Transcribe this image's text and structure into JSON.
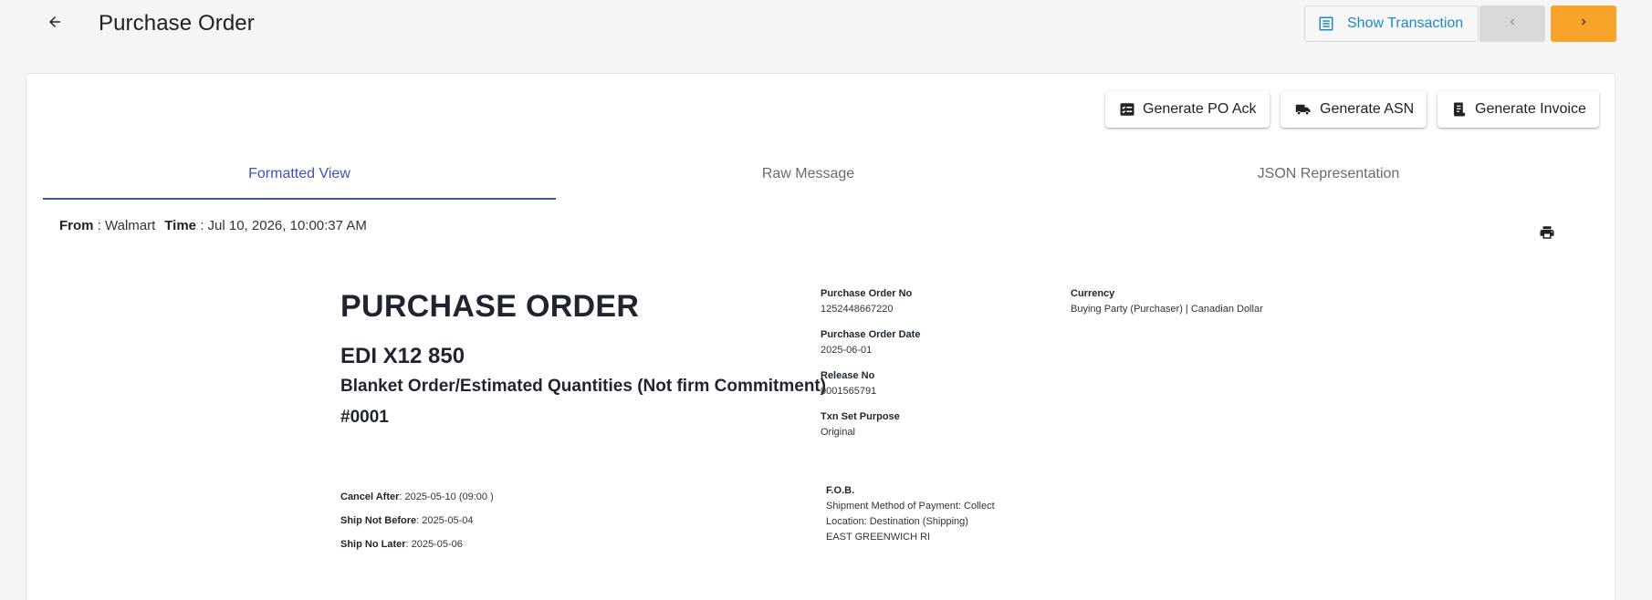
{
  "header": {
    "title": "Purchase Order",
    "show_transaction_label": "Show Transaction"
  },
  "actions": {
    "generate_po_ack": "Generate PO Ack",
    "generate_asn": "Generate ASN",
    "generate_invoice": "Generate Invoice"
  },
  "tabs": [
    {
      "label": "Formatted View",
      "active": true
    },
    {
      "label": "Raw Message",
      "active": false
    },
    {
      "label": "JSON Representation",
      "active": false
    }
  ],
  "meta": {
    "from_label": "From",
    "from_value": " : Walmart",
    "time_label": "Time",
    "time_value": " : Jul 10, 2026, 10:00:37 AM"
  },
  "document": {
    "title": "PURCHASE ORDER",
    "standard": "EDI X12 850",
    "order_type": "Blanket Order/Estimated Quantities (Not firm Commitment)",
    "number": "#0001",
    "fields": {
      "po_no_label": "Purchase Order No",
      "po_no_value": "1252448667220",
      "po_date_label": "Purchase Order Date",
      "po_date_value": "2025-06-01",
      "release_label": "Release No",
      "release_value": "0001565791",
      "txn_purpose_label": "Txn Set Purpose",
      "txn_purpose_value": "Original",
      "currency_label": "Currency",
      "currency_value": "Buying Party (Purchaser) | Canadian Dollar"
    },
    "dates": {
      "cancel_after_label": "Cancel After",
      "cancel_after_value": ": 2025-05-10  (09:00 )",
      "ship_not_before_label": "Ship Not Before",
      "ship_not_before_value": ": 2025-05-04",
      "ship_no_later_label": "Ship No Later",
      "ship_no_later_value": ": 2025-05-06"
    },
    "fob": {
      "label": "F.O.B.",
      "payment": "Shipment Method of Payment: Collect",
      "location": "Location: Destination (Shipping)",
      "place": "EAST GREENWICH RI"
    }
  },
  "colors": {
    "accent": "#3f51b5",
    "link": "#1e88c8",
    "next_button": "#f7a42b",
    "prev_button": "#d9d9d9"
  }
}
